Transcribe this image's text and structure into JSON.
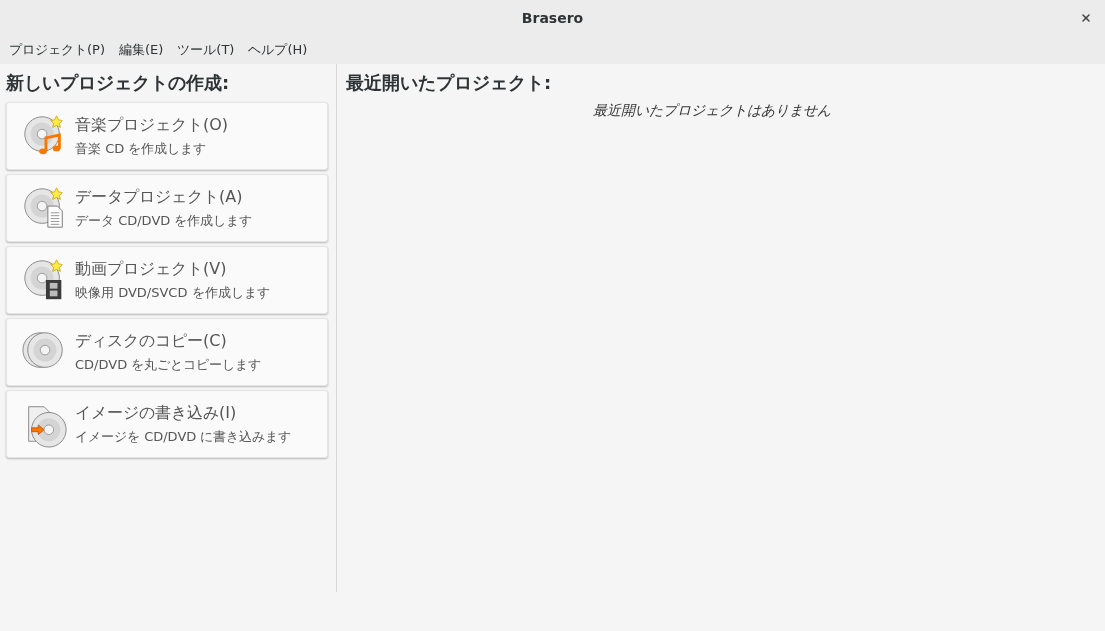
{
  "window": {
    "title": "Brasero"
  },
  "menu": [
    {
      "label": "プロジェクト(P)"
    },
    {
      "label": "編集(E)"
    },
    {
      "label": "ツール(T)"
    },
    {
      "label": "ヘルプ(H)"
    }
  ],
  "new_project": {
    "heading": "新しいプロジェクトの作成:",
    "items": [
      {
        "kind": "audio",
        "title": "音楽プロジェクト(O)",
        "description": "音楽 CD を作成します"
      },
      {
        "kind": "data",
        "title": "データプロジェクト(A)",
        "description": "データ CD/DVD を作成します"
      },
      {
        "kind": "video",
        "title": "動画プロジェクト(V)",
        "description": "映像用 DVD/SVCD を作成します"
      },
      {
        "kind": "copy",
        "title": "ディスクのコピー(C)",
        "description": "CD/DVD を丸ごとコピーします"
      },
      {
        "kind": "image",
        "title": "イメージの書き込み(I)",
        "description": "イメージを CD/DVD に書き込みます"
      }
    ]
  },
  "recent": {
    "heading": "最近開いたプロジェクト:",
    "empty_message": "最近開いたプロジェクトはありません"
  }
}
